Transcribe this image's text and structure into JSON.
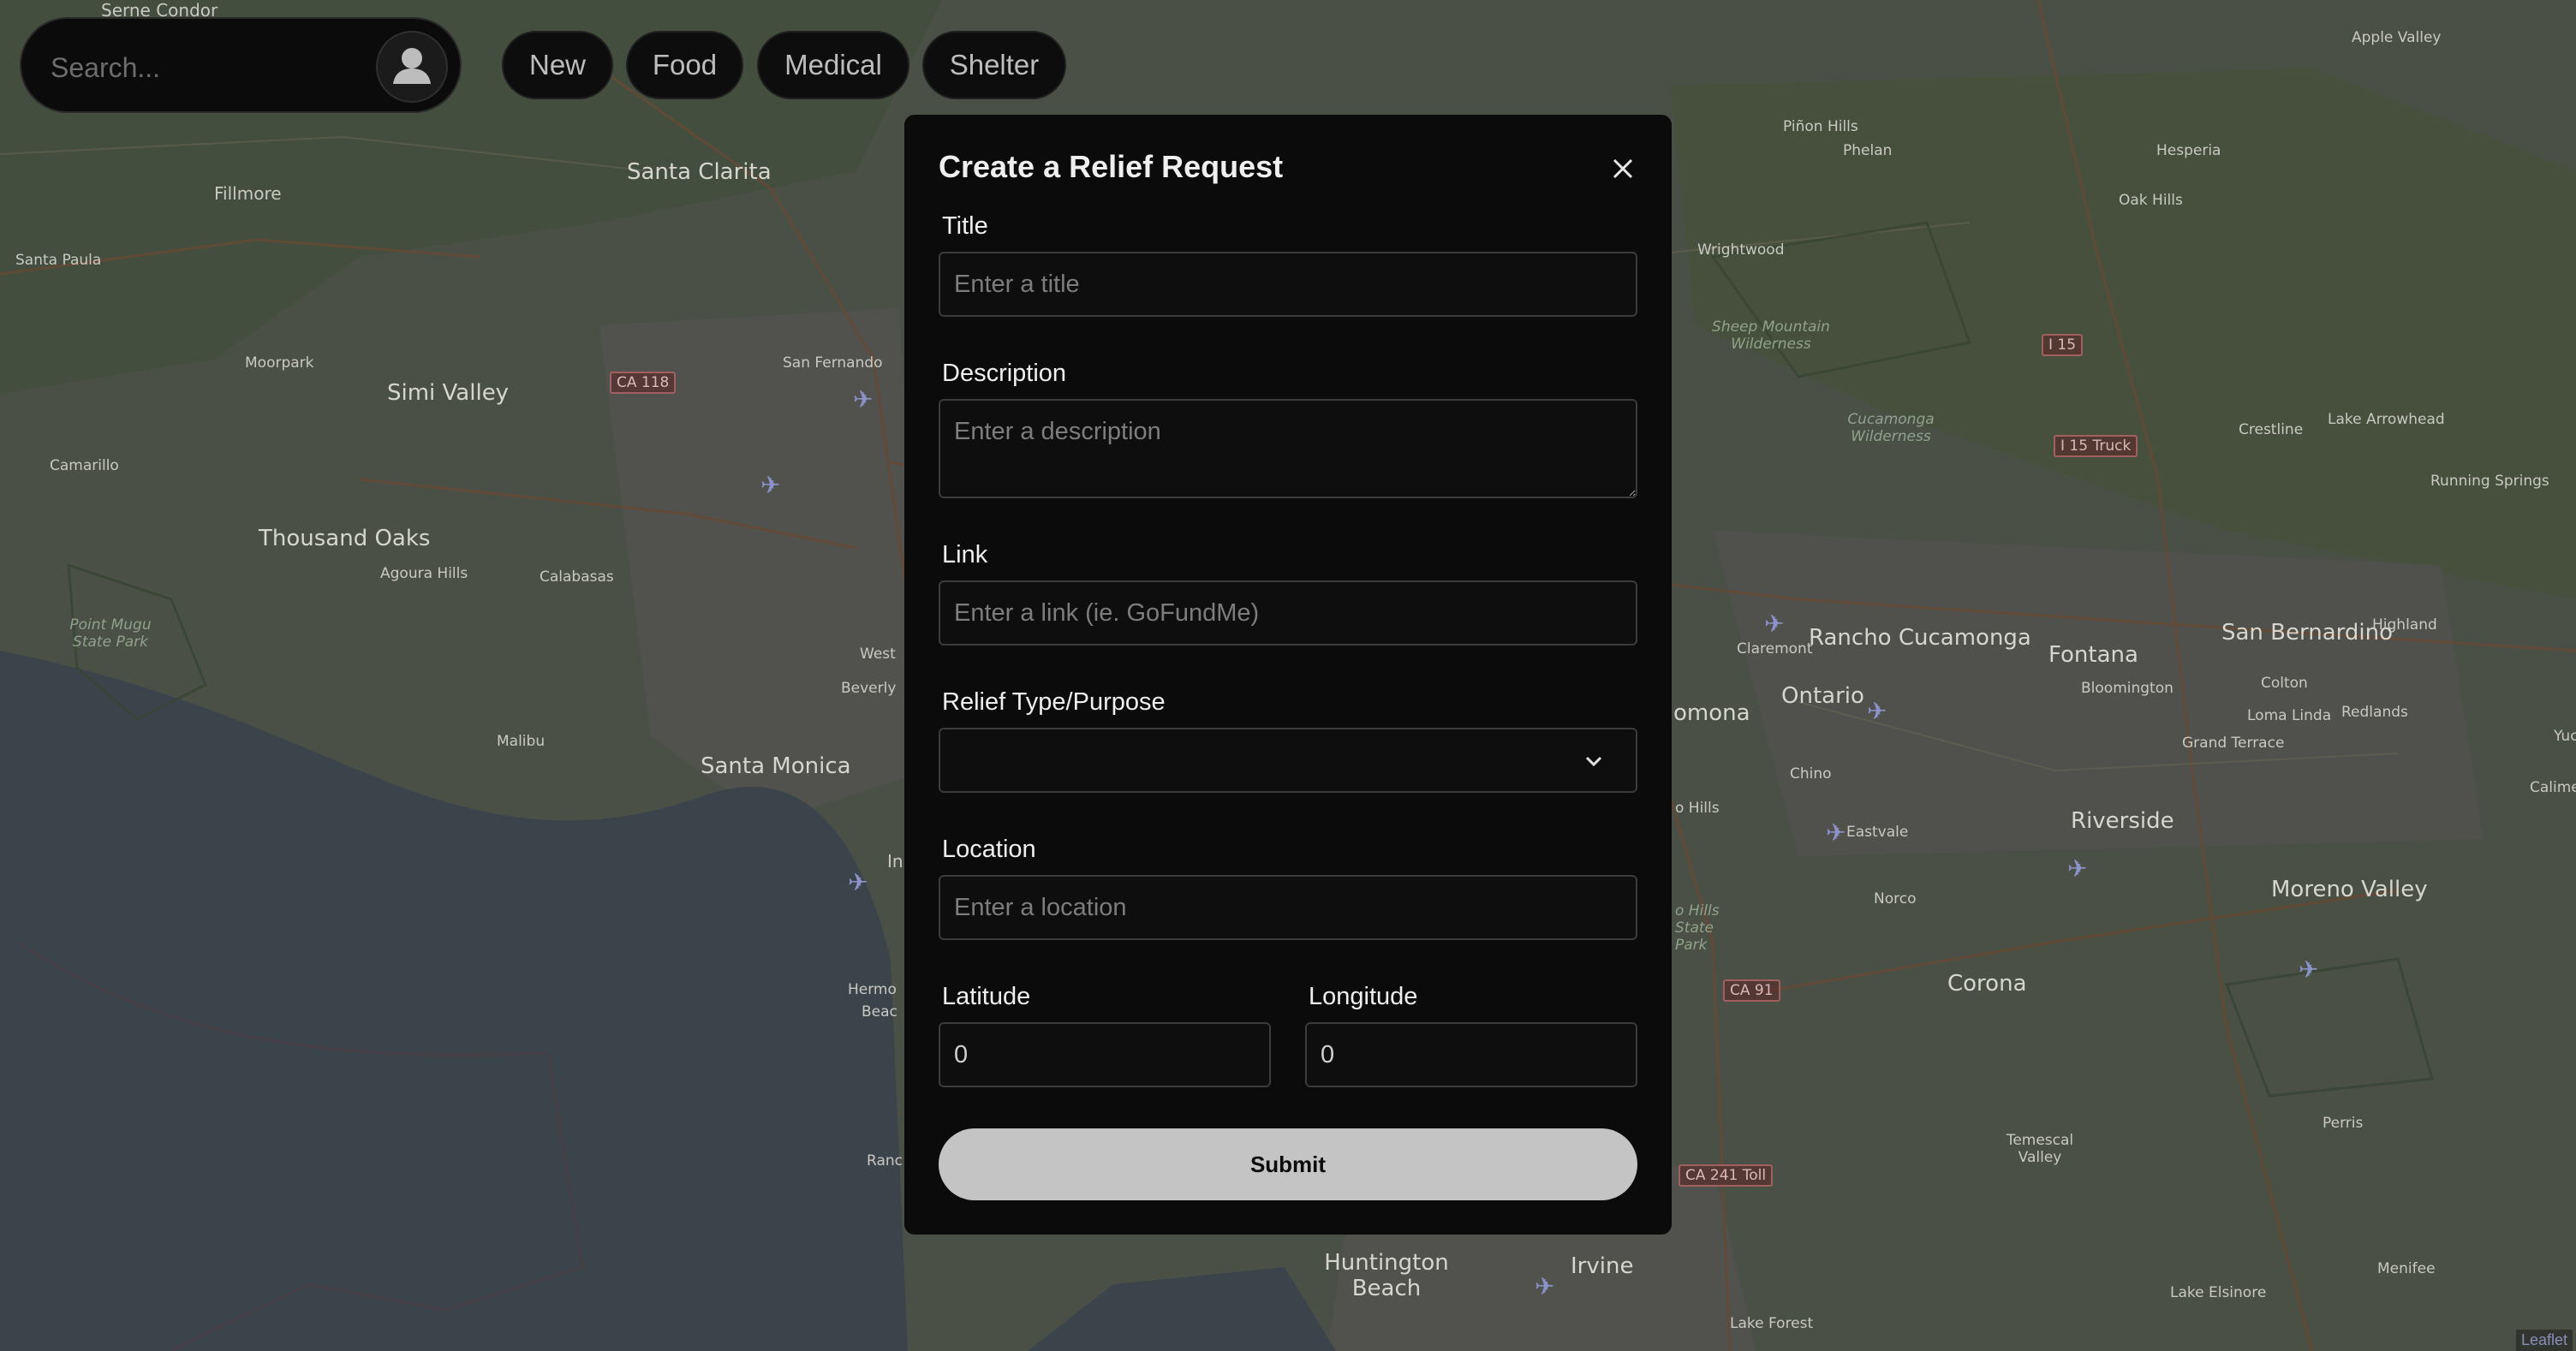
{
  "search": {
    "placeholder": "Search..."
  },
  "filters": [
    {
      "label": "New"
    },
    {
      "label": "Food"
    },
    {
      "label": "Medical"
    },
    {
      "label": "Shelter"
    }
  ],
  "modal": {
    "title": "Create a Relief Request",
    "fields": {
      "title": {
        "label": "Title",
        "placeholder": "Enter a title"
      },
      "description": {
        "label": "Description",
        "placeholder": "Enter a description"
      },
      "link": {
        "label": "Link",
        "placeholder": "Enter a link (ie. GoFundMe)"
      },
      "relief_type": {
        "label": "Relief Type/Purpose",
        "value": ""
      },
      "location": {
        "label": "Location",
        "placeholder": "Enter a location"
      },
      "latitude": {
        "label": "Latitude",
        "value": "0"
      },
      "longitude": {
        "label": "Longitude",
        "value": "0"
      }
    },
    "submit_label": "Submit"
  },
  "map": {
    "places": [
      {
        "name": "Santa Clarita"
      },
      {
        "name": "Fillmore"
      },
      {
        "name": "Santa Paula"
      },
      {
        "name": "Simi Valley"
      },
      {
        "name": "Moorpark"
      },
      {
        "name": "Camarillo"
      },
      {
        "name": "Thousand Oaks"
      },
      {
        "name": "Agoura Hills"
      },
      {
        "name": "Calabasas"
      },
      {
        "name": "Malibu"
      },
      {
        "name": "Santa Monica"
      },
      {
        "name": "San Fernando"
      },
      {
        "name": "West"
      },
      {
        "name": "Beverly"
      },
      {
        "name": "Hermo"
      },
      {
        "name": "Beac"
      },
      {
        "name": "Ranc"
      },
      {
        "name": "In"
      },
      {
        "name": "Apple Valley"
      },
      {
        "name": "Hesperia"
      },
      {
        "name": "Phelan"
      },
      {
        "name": "Piñon Hills"
      },
      {
        "name": "Oak Hills"
      },
      {
        "name": "Wrightwood"
      },
      {
        "name": "Crestline"
      },
      {
        "name": "Lake Arrowhead"
      },
      {
        "name": "Running Springs"
      },
      {
        "name": "Rancho Cucamonga"
      },
      {
        "name": "Fontana"
      },
      {
        "name": "San Bernardino"
      },
      {
        "name": "Highland"
      },
      {
        "name": "Ontario"
      },
      {
        "name": "Claremont"
      },
      {
        "name": "omona"
      },
      {
        "name": "Bloomington"
      },
      {
        "name": "Colton"
      },
      {
        "name": "Loma Linda"
      },
      {
        "name": "Redlands"
      },
      {
        "name": "Yuc"
      },
      {
        "name": "Grand Terrace"
      },
      {
        "name": "Calime"
      },
      {
        "name": "Chino"
      },
      {
        "name": "o Hills"
      },
      {
        "name": "Riverside"
      },
      {
        "name": "Eastvale"
      },
      {
        "name": "Norco"
      },
      {
        "name": "Moreno Valley"
      },
      {
        "name": "Corona"
      },
      {
        "name": "Perris"
      },
      {
        "name": "Temescal Valley"
      },
      {
        "name": "Huntington Beach"
      },
      {
        "name": "Irvine"
      },
      {
        "name": "Lake Forest"
      },
      {
        "name": "Menifee"
      },
      {
        "name": "Lake Elsinore"
      },
      {
        "name": "Serne Condor"
      }
    ],
    "parks": [
      {
        "name": "Point Mugu State Park"
      },
      {
        "name": "Sheep Mountain Wilderness"
      },
      {
        "name": "Cucamonga Wilderness"
      },
      {
        "name": "o Hills State Park"
      }
    ],
    "shields": [
      {
        "name": "CA 118"
      },
      {
        "name": "I 15"
      },
      {
        "name": "I 15 Truck"
      },
      {
        "name": "CA 91"
      },
      {
        "name": "CA 241 Toll"
      }
    ],
    "attribution": "Leaflet"
  }
}
